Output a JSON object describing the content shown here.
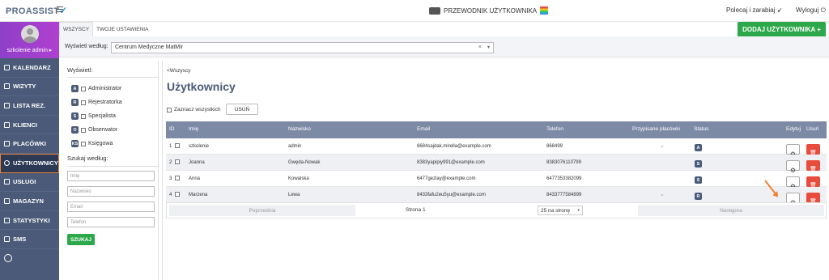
{
  "header": {
    "logo": "PROASSIST",
    "guide": "PRZEWODNIK UŻYTKOWNIKA",
    "recommend": "Polecaj i zarabiaj",
    "logout": "Wyloguj"
  },
  "sidebar": {
    "profile_name": "szkolenie admin ▸",
    "items": [
      {
        "label": "KALENDARZ",
        "icon": "calendar-icon"
      },
      {
        "label": "WIZYTY",
        "icon": "list-icon"
      },
      {
        "label": "LISTA REZ.",
        "icon": "clipboard-icon"
      },
      {
        "label": "KLIENCI",
        "icon": "users-icon"
      },
      {
        "label": "PLACÓWKI",
        "icon": "building-icon"
      },
      {
        "label": "UŻYTKOWNICY",
        "icon": "user-icon"
      },
      {
        "label": "USŁUGI",
        "icon": "grid-icon"
      },
      {
        "label": "MAGAZYN",
        "icon": "box-icon"
      },
      {
        "label": "STATYSTYKI",
        "icon": "bar-chart-icon"
      },
      {
        "label": "SMS",
        "icon": "message-icon"
      }
    ]
  },
  "tabs": [
    "WSZYSCY",
    "TWOJE USTAWIENIA"
  ],
  "add_user_label": "DODAJ UŻYTKOWNIKA +",
  "filter": {
    "label": "Wyświetl według:",
    "value": "Centrum Medyczne MatMir",
    "clear": "×",
    "caret": "▾"
  },
  "left_panel": {
    "show_title": "Wyświetl:",
    "roles": [
      {
        "badge": "A",
        "label": "Administrator"
      },
      {
        "badge": "R",
        "label": "Rejestratorka"
      },
      {
        "badge": "S",
        "label": "Specjalista"
      },
      {
        "badge": "O",
        "label": "Obserwator"
      },
      {
        "badge": "KS",
        "label": "Księgowa"
      }
    ],
    "search_title": "Szukaj według:",
    "inputs": [
      "Imię",
      "Nazwisko",
      "Email",
      "Telefon"
    ],
    "search_button": "SZUKAJ"
  },
  "main": {
    "back_link": "<Wszyscy",
    "title": "Użytkownicy",
    "select_all": "Zaznacz wszystkich",
    "delete_label": "USUŃ",
    "columns": {
      "id": "ID",
      "first": "Imię",
      "last": "Nazwisko",
      "email": "Email",
      "phone": "Telefon",
      "places": "Przypisane placówki",
      "status": "Status",
      "edit": "Edytuj",
      "remove": "Usuń"
    },
    "rows": [
      {
        "id": "1",
        "first": "szkolenie",
        "last": "admin",
        "email": "8684sajdak.mirella@example.com",
        "phone": "868499",
        "status": "A"
      },
      {
        "id": "2",
        "first": "Joanna",
        "last": "Gwęda-Nowak",
        "email": "8383yapipiy991@example.com",
        "phone": "8383076110799",
        "status": "S"
      },
      {
        "id": "3",
        "first": "Anna",
        "last": "Kowalska",
        "email": "6477gezlay@example.com",
        "phone": "6477353382099",
        "status": "S"
      },
      {
        "id": "4",
        "first": "Marzena",
        "last": "Lewa",
        "email": "8433fafu2eu5yu@example.com",
        "phone": "8433777584899",
        "status": "R"
      }
    ],
    "pager": {
      "prev": "Poprzednia",
      "page": "Strona 1",
      "size": "25 na stronę",
      "next": "Następna"
    }
  }
}
